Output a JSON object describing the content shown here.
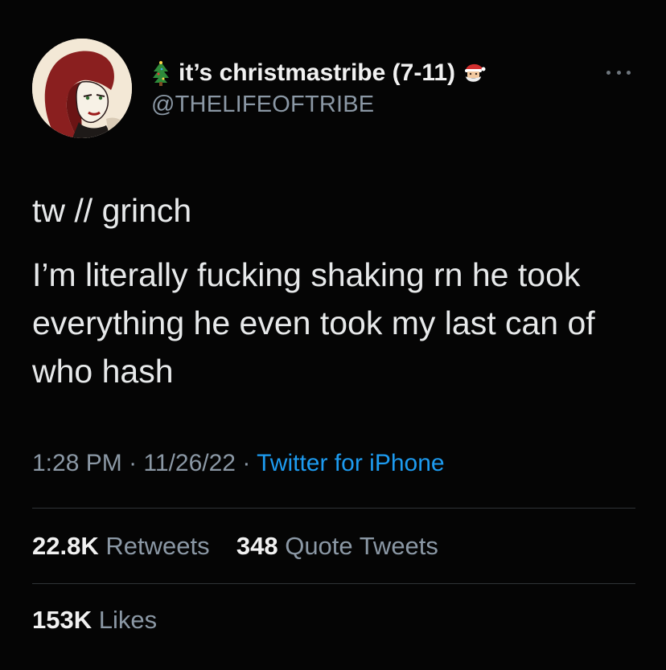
{
  "author": {
    "display_name": "it’s christmastribe (7-11)",
    "handle": "@THELIFEOFTRIBE",
    "name_prefix_icon": "christmas-tree-icon",
    "name_suffix_icon": "santa-icon"
  },
  "tweet": {
    "lines": [
      "tw // grinch",
      "I’m literally fucking shaking rn he took everything he even took my last can of who hash"
    ]
  },
  "meta": {
    "time": "1:28 PM",
    "date": "11/26/22",
    "separator": "·",
    "source": "Twitter for iPhone"
  },
  "stats": {
    "retweets_count": "22.8K",
    "retweets_label": "Retweets",
    "quotes_count": "348",
    "quotes_label": "Quote Tweets",
    "likes_count": "153K",
    "likes_label": "Likes"
  },
  "colors": {
    "background": "#050505",
    "text": "#e7e9ea",
    "secondary": "#8b98a5",
    "link": "#1d9bf0",
    "divider": "#2f3336"
  }
}
